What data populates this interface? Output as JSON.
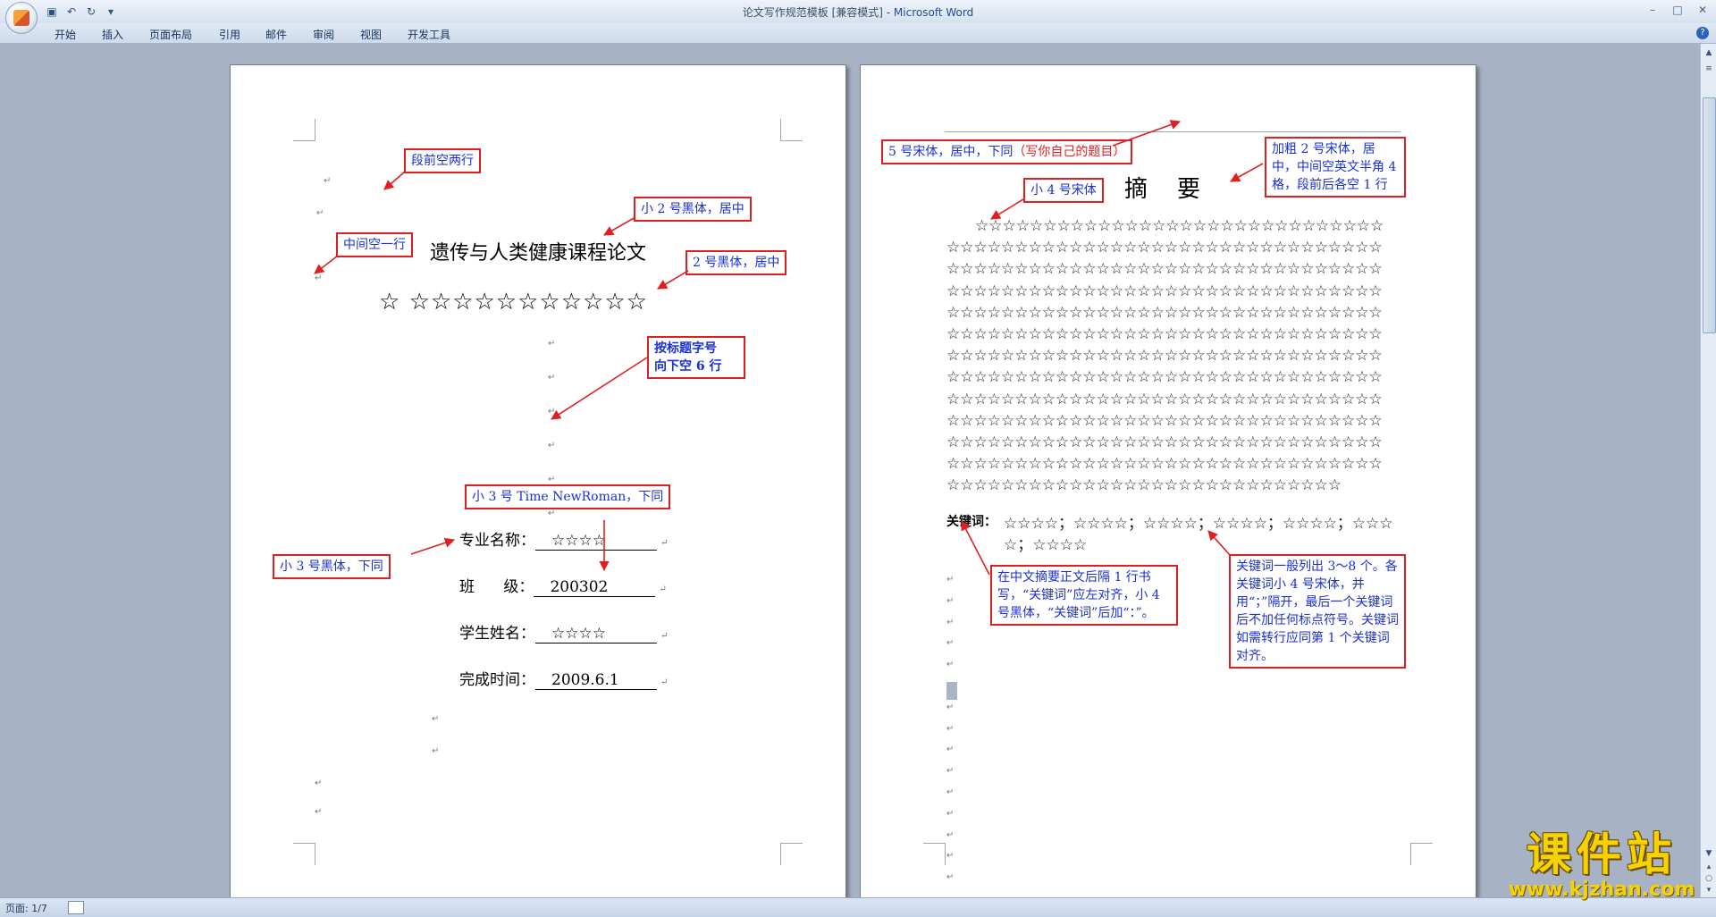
{
  "window": {
    "title": "论文写作规范模板 [兼容模式] - ",
    "app_name": "Microsoft Word"
  },
  "ribbon": {
    "tabs": [
      "开始",
      "插入",
      "页面布局",
      "引用",
      "邮件",
      "审阅",
      "视图",
      "开发工具"
    ]
  },
  "page1": {
    "title": "遗传与人类健康课程论文",
    "stars_line": "☆ ☆☆☆☆☆☆☆☆☆☆☆",
    "fields": [
      {
        "label": "专业名称：",
        "value": "☆☆☆☆"
      },
      {
        "label": "班      级：",
        "value": "200302"
      },
      {
        "label": "学生姓名：",
        "value": "☆☆☆☆"
      },
      {
        "label": "完成时间：",
        "value": "2009.6.1"
      }
    ],
    "annotations": {
      "before_space": "段前空两行",
      "title_font": "小 2 号黑体，居中",
      "middle_blank": "中间空一行",
      "subtitle_font": "2 号黑体，居中",
      "blank_lines_1": "按标题字号",
      "blank_lines_2": "向下空 6 行",
      "fields_font_en": "小 3 号 Time NewRoman，下同",
      "fields_font_cn": "小 3 号黑体，下同"
    }
  },
  "page2": {
    "heading": "摘    要",
    "abstract_lines": [
      "☆☆☆☆☆☆☆☆☆☆☆☆☆☆☆☆☆☆☆☆☆☆☆☆☆☆☆☆☆☆",
      "☆☆☆☆☆☆☆☆☆☆☆☆☆☆☆☆☆☆☆☆☆☆☆☆☆☆☆☆☆☆☆☆",
      "☆☆☆☆☆☆☆☆☆☆☆☆☆☆☆☆☆☆☆☆☆☆☆☆☆☆☆☆☆☆☆☆",
      "☆☆☆☆☆☆☆☆☆☆☆☆☆☆☆☆☆☆☆☆☆☆☆☆☆☆☆☆☆☆☆☆",
      "☆☆☆☆☆☆☆☆☆☆☆☆☆☆☆☆☆☆☆☆☆☆☆☆☆☆☆☆☆☆☆☆",
      "☆☆☆☆☆☆☆☆☆☆☆☆☆☆☆☆☆☆☆☆☆☆☆☆☆☆☆☆☆☆☆☆",
      "☆☆☆☆☆☆☆☆☆☆☆☆☆☆☆☆☆☆☆☆☆☆☆☆☆☆☆☆☆☆☆☆",
      "☆☆☆☆☆☆☆☆☆☆☆☆☆☆☆☆☆☆☆☆☆☆☆☆☆☆☆☆☆☆☆☆",
      "☆☆☆☆☆☆☆☆☆☆☆☆☆☆☆☆☆☆☆☆☆☆☆☆☆☆☆☆☆☆☆☆",
      "☆☆☆☆☆☆☆☆☆☆☆☆☆☆☆☆☆☆☆☆☆☆☆☆☆☆☆☆☆☆☆☆",
      "☆☆☆☆☆☆☆☆☆☆☆☆☆☆☆☆☆☆☆☆☆☆☆☆☆☆☆☆☆☆☆☆",
      "☆☆☆☆☆☆☆☆☆☆☆☆☆☆☆☆☆☆☆☆☆☆☆☆☆☆☆☆☆☆☆☆",
      "☆☆☆☆☆☆☆☆☆☆☆☆☆☆☆☆☆☆☆☆☆☆☆☆☆☆☆☆☆"
    ],
    "keywords_label": "关键词：",
    "keywords_line1": "☆☆☆☆；☆☆☆☆；☆☆☆☆；☆☆☆☆；☆☆☆☆；☆☆☆",
    "keywords_line2": "☆；☆☆☆☆",
    "annotations": {
      "title_note_a": "5 号宋体，居中，下同",
      "title_note_b": "（写你自己的题目）",
      "heading_note": "加粗 2 号宋体，居中，中间空英文半角 4 格，段前后各空 1 行",
      "abstract_font": "小 4 号宋体",
      "keywords_note": "在中文摘要正文后隔 1 行书写，“关键词”应左对齐，小 4 号黑体，“关键词”后加“：”。",
      "keywords_rule": "关键词一般列出 3～8 个。各关键词小 4 号宋体，并用“；”隔开，最后一个关键词后不加任何标点符号。关键词如需转行应同第 1 个关键词对齐。"
    }
  },
  "status": {
    "page": "页面: 1/7"
  },
  "watermark": {
    "brand": "课件站",
    "url": "www.kjzhan.com"
  },
  "colors": {
    "annotation_border": "#e02020",
    "annotation_text": "#1a2fd6",
    "background": "#a9b6c7"
  }
}
